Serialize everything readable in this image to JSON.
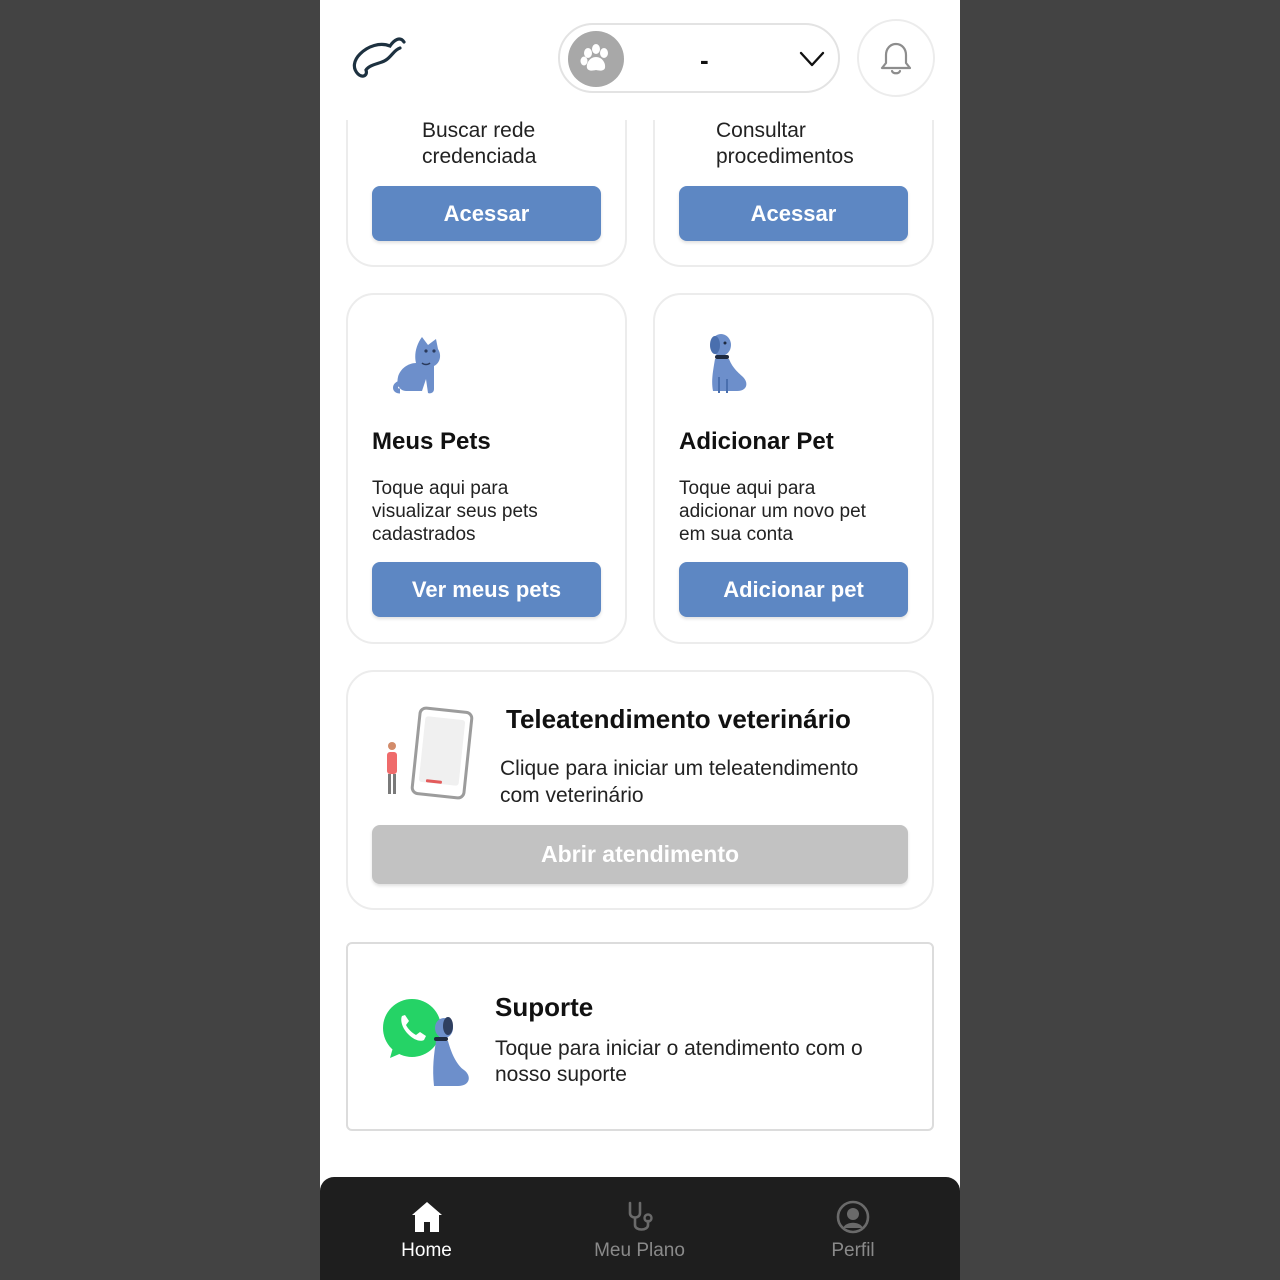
{
  "header": {
    "selected_pet": "-",
    "icons": [
      "logo-icon",
      "paw-icon",
      "chevron-down-icon",
      "bell-icon"
    ]
  },
  "cards_top": [
    {
      "text_line1": "Buscar rede",
      "text_line2": "credenciada",
      "button": "Acessar"
    },
    {
      "text_line1": "Consultar",
      "text_line2": "procedimentos",
      "button": "Acessar"
    }
  ],
  "meus_pets": {
    "title": "Meus Pets",
    "desc1": "Toque aqui para",
    "desc2": "visualizar seus pets",
    "desc3": "cadastrados",
    "button": "Ver meus pets"
  },
  "adicionar_pet": {
    "title": "Adicionar Pet",
    "desc1": "Toque aqui para",
    "desc2": "adicionar um novo pet",
    "desc3": "em sua conta",
    "button": "Adicionar pet"
  },
  "tele": {
    "title": "Teleatendimento veterinário",
    "desc1": "Clique para iniciar um teleatendimento",
    "desc2": "com veterinário",
    "button": "Abrir atendimento"
  },
  "suporte": {
    "title": "Suporte",
    "desc1": "Toque para iniciar o atendimento com o",
    "desc2": "nosso suporte"
  },
  "nav": {
    "items": [
      {
        "label": "Home",
        "icon": "home-icon",
        "active": true
      },
      {
        "label": "Meu Plano",
        "icon": "stethoscope-icon",
        "active": false
      },
      {
        "label": "Perfil",
        "icon": "profile-icon",
        "active": false
      }
    ]
  },
  "colors": {
    "accent": "#5d87c3",
    "disabled": "#c2c2c2",
    "nav_bg": "#1e1e1e",
    "whatsapp": "#25d366"
  }
}
